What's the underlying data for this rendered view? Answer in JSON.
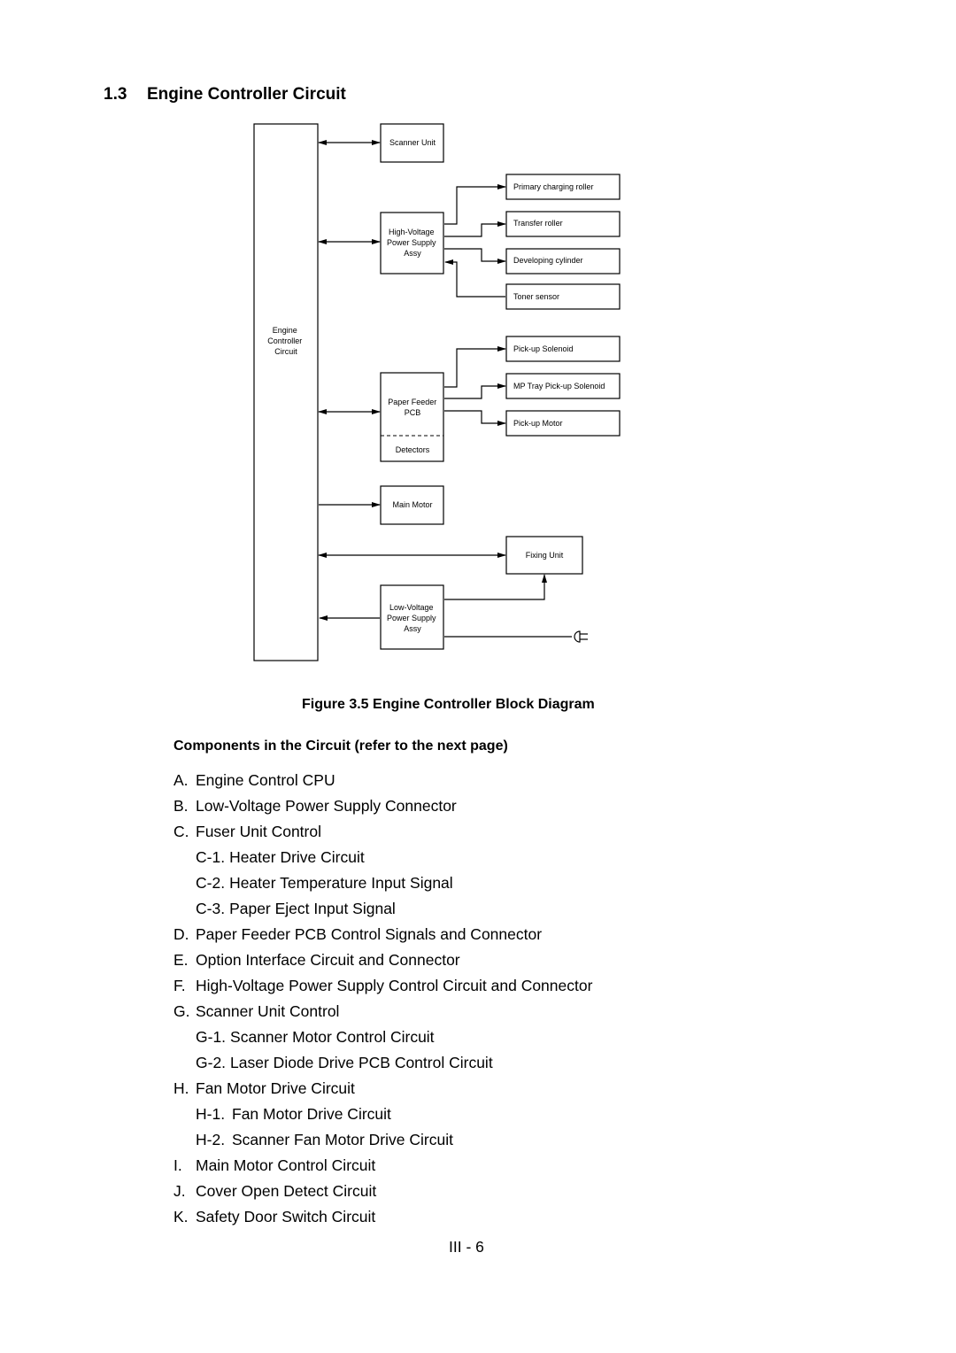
{
  "section": {
    "number": "1.3",
    "title": "Engine Controller Circuit"
  },
  "diagram": {
    "main_block": "Engine Controller Circuit",
    "main_block_lines": [
      "Engine",
      "Controller",
      "Circuit"
    ],
    "blocks": {
      "scanner_unit": [
        "Scanner Unit"
      ],
      "hv_power_supply": [
        "High-Voltage",
        "Power Supply",
        "Assy"
      ],
      "primary_charging_roller": [
        "Primary charging roller"
      ],
      "transfer_roller": [
        "Transfer roller"
      ],
      "developing_cylinder": [
        "Developing cylinder"
      ],
      "toner_sensor": [
        "Toner sensor"
      ],
      "pickup_solenoid": [
        "Pick-up Solenoid"
      ],
      "mp_tray_pickup_solenoid": [
        "MP Tray Pick-up Solenoid"
      ],
      "paper_feeder_pcb": [
        "Paper Feeder",
        "PCB"
      ],
      "detectors": [
        "Detectors"
      ],
      "pickup_motor": [
        "Pick-up Motor"
      ],
      "main_motor": [
        "Main Motor"
      ],
      "fixing_unit": [
        "Fixing Unit"
      ],
      "lv_power_supply": [
        "Low-Voltage",
        "Power Supply",
        "Assy"
      ]
    },
    "connections": [
      {
        "from": "Engine Controller Circuit",
        "to": "Scanner Unit",
        "direction": "bidirectional"
      },
      {
        "from": "Engine Controller Circuit",
        "to": "High-Voltage Power Supply Assy",
        "direction": "bidirectional"
      },
      {
        "from": "High-Voltage Power Supply Assy",
        "to": "Primary charging roller",
        "direction": "forward"
      },
      {
        "from": "High-Voltage Power Supply Assy",
        "to": "Transfer roller",
        "direction": "forward"
      },
      {
        "from": "High-Voltage Power Supply Assy",
        "to": "Developing cylinder",
        "direction": "forward"
      },
      {
        "from": "Toner sensor",
        "to": "High-Voltage Power Supply Assy",
        "direction": "forward"
      },
      {
        "from": "Engine Controller Circuit",
        "to": "Paper Feeder PCB",
        "direction": "bidirectional"
      },
      {
        "from": "Paper Feeder PCB",
        "to": "Pick-up Solenoid",
        "direction": "forward"
      },
      {
        "from": "Paper Feeder PCB",
        "to": "MP Tray Pick-up Solenoid",
        "direction": "forward"
      },
      {
        "from": "Paper Feeder PCB",
        "to": "Pick-up Motor",
        "direction": "forward"
      },
      {
        "from": "Engine Controller Circuit",
        "to": "Main Motor",
        "direction": "forward"
      },
      {
        "from": "Engine Controller Circuit",
        "to": "Fixing Unit",
        "direction": "bidirectional"
      },
      {
        "from": "Low-Voltage Power Supply Assy",
        "to": "Fixing Unit",
        "direction": "forward"
      },
      {
        "from": "Low-Voltage Power Supply Assy",
        "to": "Engine Controller Circuit",
        "direction": "forward"
      },
      {
        "from": "AC plug",
        "to": "Low-Voltage Power Supply Assy",
        "direction": "none"
      }
    ]
  },
  "figure_caption": "Figure 3.5 Engine Controller Block Diagram",
  "components_heading": "Components in the Circuit (refer to the next page)",
  "components": [
    {
      "marker": "A.",
      "text": "Engine Control CPU",
      "level": 0
    },
    {
      "marker": "B.",
      "text": "Low-Voltage Power Supply Connector",
      "level": 0
    },
    {
      "marker": "C.",
      "text": "Fuser Unit Control",
      "level": 0
    },
    {
      "marker": "C-1.",
      "text": "Heater Drive Circuit",
      "level": 1
    },
    {
      "marker": "C-2.",
      "text": "Heater Temperature Input Signal",
      "level": 1
    },
    {
      "marker": "C-3.",
      "text": "Paper Eject Input Signal",
      "level": 1
    },
    {
      "marker": "D.",
      "text": "Paper Feeder PCB Control Signals and Connector",
      "level": 0
    },
    {
      "marker": "E.",
      "text": "Option Interface Circuit and Connector",
      "level": 0
    },
    {
      "marker": "F.",
      "text": "High-Voltage Power Supply Control Circuit and Connector",
      "level": 0
    },
    {
      "marker": "G.",
      "text": "Scanner Unit Control",
      "level": 0
    },
    {
      "marker": "G-1.",
      "text": "Scanner Motor Control Circuit",
      "level": 1
    },
    {
      "marker": "G-2.",
      "text": "Laser Diode Drive PCB Control Circuit",
      "level": 1
    },
    {
      "marker": "H.",
      "text": "Fan Motor Drive Circuit",
      "level": 0
    },
    {
      "marker": "H-1.",
      "text": "Fan Motor Drive Circuit",
      "level": 1
    },
    {
      "marker": "H-2.",
      "text": "Scanner Fan Motor Drive Circuit",
      "level": 1
    },
    {
      "marker": "I.",
      "text": "Main Motor Control Circuit",
      "level": 0
    },
    {
      "marker": "J.",
      "text": "Cover Open Detect Circuit",
      "level": 0
    },
    {
      "marker": "K.",
      "text": "Safety Door Switch Circuit",
      "level": 0
    }
  ],
  "page_number": "III - 6"
}
